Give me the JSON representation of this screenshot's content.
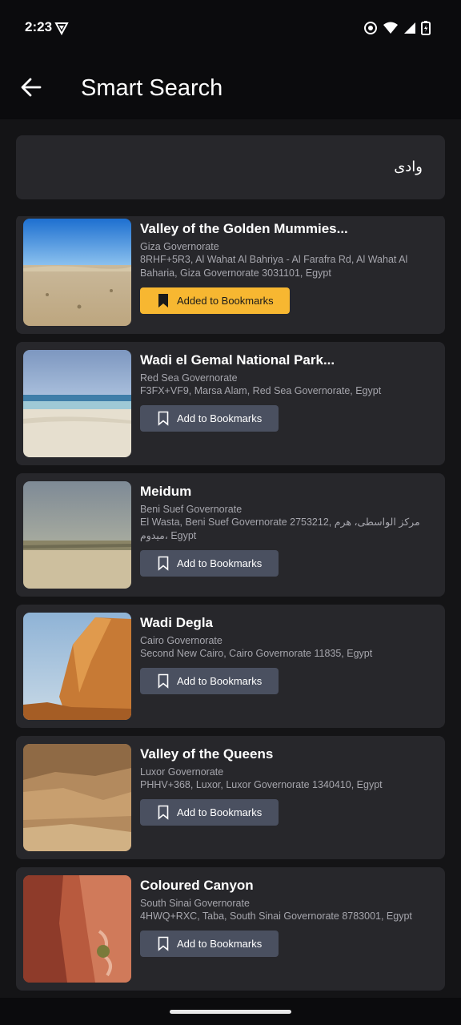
{
  "status": {
    "time": "2:23"
  },
  "header": {
    "title": "Smart Search"
  },
  "search": {
    "query": "وادى"
  },
  "results": [
    {
      "title": "Valley of the Golden Mummies...",
      "governorate": "Giza Governorate",
      "address": "8RHF+5R3, Al Wahat Al Bahriya - Al Farafra Rd, Al Wahat Al Baharia, Giza Governorate 3031101, Egypt",
      "bookmark_label": "Added to Bookmarks",
      "bookmarked": true
    },
    {
      "title": "Wadi el Gemal National Park...",
      "governorate": "Red Sea Governorate",
      "address": "F3FX+VF9, Marsa Alam, Red Sea Governorate, Egypt",
      "bookmark_label": "Add to Bookmarks",
      "bookmarked": false
    },
    {
      "title": "Meidum",
      "governorate": "Beni Suef Governorate",
      "address": "El Wasta, Beni Suef Governorate 2753212, مركز الواسطى، هرم ميدوم، Egypt",
      "bookmark_label": "Add to Bookmarks",
      "bookmarked": false
    },
    {
      "title": "Wadi Degla",
      "governorate": "Cairo Governorate",
      "address": "Second New Cairo, Cairo Governorate 11835, Egypt",
      "bookmark_label": "Add to Bookmarks",
      "bookmarked": false
    },
    {
      "title": "Valley of the Queens",
      "governorate": "Luxor Governorate",
      "address": "PHHV+368, Luxor, Luxor Governorate 1340410, Egypt",
      "bookmark_label": "Add to Bookmarks",
      "bookmarked": false
    },
    {
      "title": "Coloured Canyon",
      "governorate": "South Sinai Governorate",
      "address": "4HWQ+RXC, Taba, South Sinai Governorate 8783001, Egypt",
      "bookmark_label": "Add to Bookmarks",
      "bookmarked": false
    }
  ],
  "colors": {
    "background": "#141416",
    "card": "#27272b",
    "bookmarked_button": "#f7b731",
    "bookmark_button": "#4a5060"
  }
}
